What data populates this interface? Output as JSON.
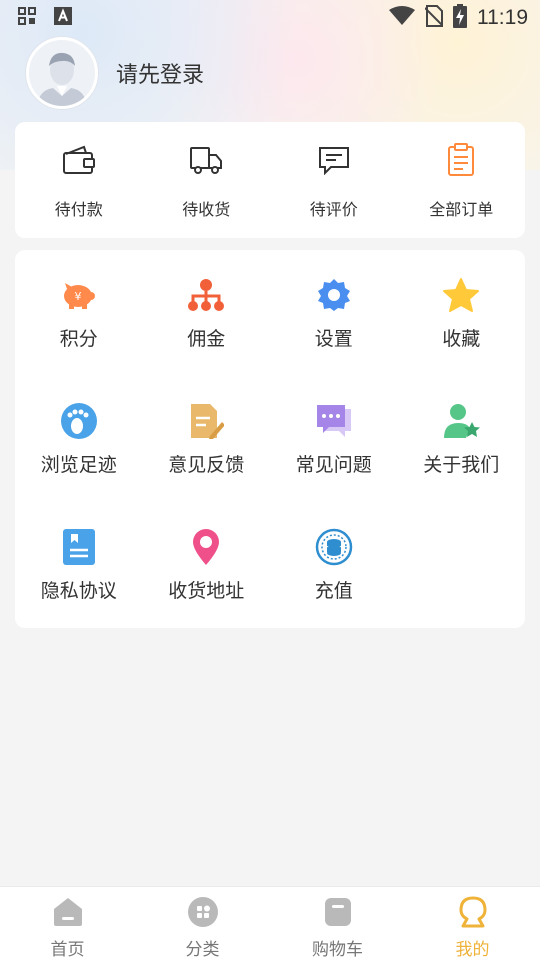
{
  "status_bar": {
    "time": "11:19"
  },
  "profile": {
    "login_text": "请先登录"
  },
  "orders": [
    {
      "label": "待付款",
      "icon": "wallet-icon"
    },
    {
      "label": "待收货",
      "icon": "truck-icon"
    },
    {
      "label": "待评价",
      "icon": "comment-icon"
    },
    {
      "label": "全部订单",
      "icon": "clipboard-icon"
    }
  ],
  "services": [
    {
      "label": "积分",
      "icon": "piggy-bank-icon",
      "color": "#ff8a4c"
    },
    {
      "label": "佣金",
      "icon": "org-chart-icon",
      "color": "#f2603a"
    },
    {
      "label": "设置",
      "icon": "gear-icon",
      "color": "#4a8ef0"
    },
    {
      "label": "收藏",
      "icon": "star-icon",
      "color": "#ffc93a"
    },
    {
      "label": "浏览足迹",
      "icon": "footprint-icon",
      "color": "#4aa3e8"
    },
    {
      "label": "意见反馈",
      "icon": "feedback-icon",
      "color": "#e9b86a"
    },
    {
      "label": "常见问题",
      "icon": "faq-icon",
      "color": "#a685e8"
    },
    {
      "label": "关于我们",
      "icon": "user-star-icon",
      "color": "#55c688"
    },
    {
      "label": "隐私协议",
      "icon": "document-icon",
      "color": "#4aa3e8"
    },
    {
      "label": "收货地址",
      "icon": "location-pin-icon",
      "color": "#f0508a"
    },
    {
      "label": "充值",
      "icon": "coin-icon",
      "color": "#2f8ed0"
    }
  ],
  "tabbar": [
    {
      "label": "首页",
      "icon": "home-icon",
      "active": false
    },
    {
      "label": "分类",
      "icon": "category-icon",
      "active": false
    },
    {
      "label": "购物车",
      "icon": "cart-icon",
      "active": false
    },
    {
      "label": "我的",
      "icon": "profile-icon",
      "active": true
    }
  ],
  "colors": {
    "accent": "#f0b33a",
    "order_highlight": "#ff8a3c"
  }
}
